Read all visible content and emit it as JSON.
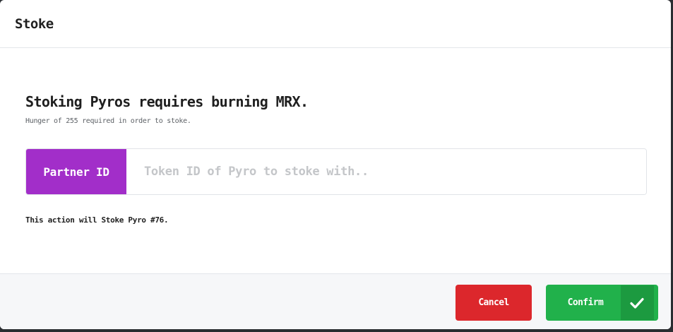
{
  "modal": {
    "title": "Stoke",
    "heading": "Stoking Pyros requires burning MRX.",
    "subtext": "Hunger of 255 required in order to stoke.",
    "input": {
      "addon_label": "Partner ID",
      "placeholder": "Token ID of Pyro to stoke with..",
      "value": ""
    },
    "notice": "This action will Stoke Pyro #76.",
    "buttons": {
      "cancel_label": "Cancel",
      "confirm_label": "Confirm",
      "confirm_icon": "check-icon"
    }
  },
  "colors": {
    "partner_addon": "#a22ec9",
    "cancel": "#dc272c",
    "confirm": "#21b14b"
  }
}
